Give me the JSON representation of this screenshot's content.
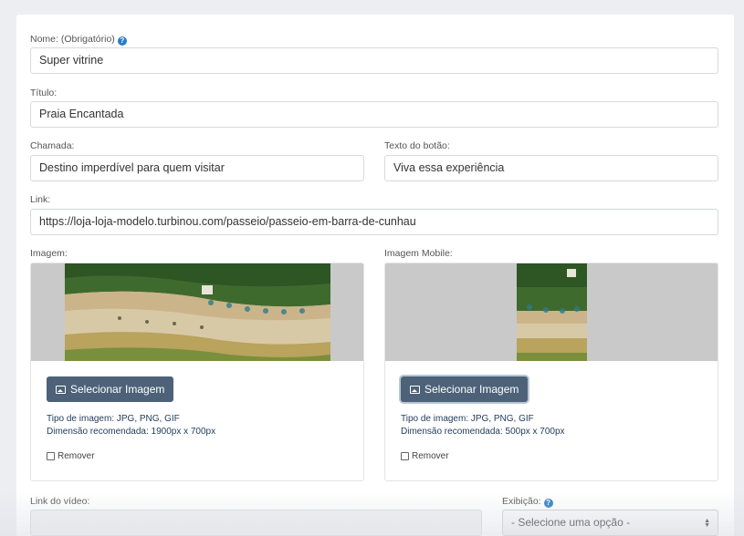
{
  "form": {
    "nome": {
      "label": "Nome: (Obrigatório)",
      "value": "Super vitrine"
    },
    "titulo": {
      "label": "Título:",
      "value": "Praia Encantada"
    },
    "chamada": {
      "label": "Chamada:",
      "value": "Destino imperdível para quem visitar"
    },
    "texto_botao": {
      "label": "Texto do botão:",
      "value": "Viva essa experiência"
    },
    "link": {
      "label": "Link:",
      "value": "https://loja-loja-modelo.turbinou.com/passeio/passeio-em-barra-de-cunhau"
    },
    "imagem": {
      "label": "Imagem:",
      "button_label": "Selecionar Imagem",
      "tipo": "Tipo de imagem: JPG, PNG, GIF",
      "dimensao": "Dimensão recomendada: 1900px x 700px",
      "remover": "Remover"
    },
    "imagem_mobile": {
      "label": "Imagem Mobile:",
      "button_label": "Selecionar Imagem",
      "tipo": "Tipo de imagem: JPG, PNG, GIF",
      "dimensao": "Dimensão recomendada: 500px x 700px",
      "remover": "Remover"
    },
    "link_video": {
      "label": "Link do vídeo:",
      "value": ""
    },
    "exibicao": {
      "label": "Exibição:",
      "selected": "- Selecione uma opção -"
    }
  },
  "icons": {
    "help": "question-circle-icon",
    "image": "image-icon",
    "select_arrows": "sort-arrows-icon"
  },
  "colors": {
    "button_bg": "#4d6278",
    "help_icon": "#2a7cc7",
    "hint_text": "#1f3b5a"
  }
}
